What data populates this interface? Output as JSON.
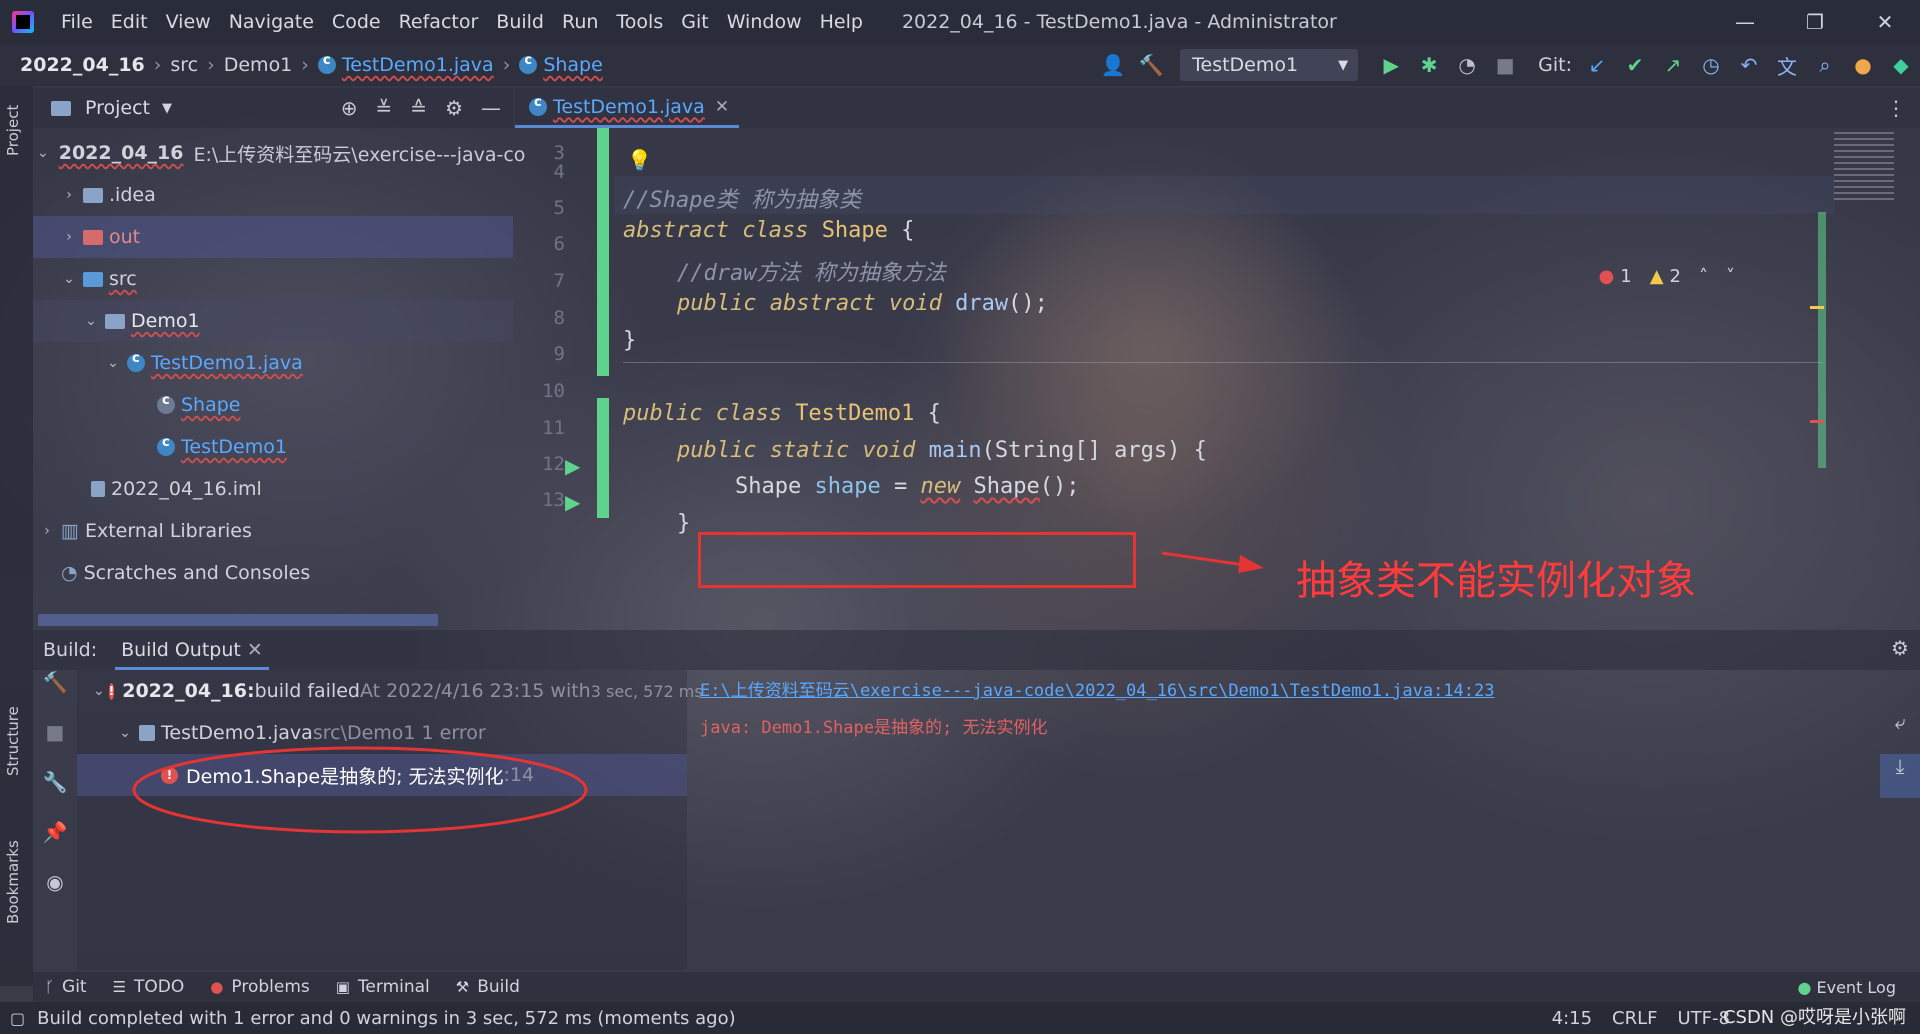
{
  "window": {
    "title": "2022_04_16 - TestDemo1.java - Administrator",
    "menu": [
      "File",
      "Edit",
      "View",
      "Navigate",
      "Code",
      "Refactor",
      "Build",
      "Run",
      "Tools",
      "Git",
      "Window",
      "Help"
    ],
    "controls": {
      "minimize": "—",
      "restore": "❐",
      "close": "✕"
    }
  },
  "breadcrumb": [
    "2022_04_16",
    "src",
    "Demo1",
    "TestDemo1.java",
    "Shape"
  ],
  "toolbar": {
    "run_config": "TestDemo1",
    "git_label": "Git:"
  },
  "left_stripe": {
    "project": "Project",
    "structure": "Structure",
    "bookmarks": "Bookmarks"
  },
  "project_panel": {
    "title": "Project",
    "tree": [
      {
        "label": "2022_04_16",
        "path": "E:\\上传资料至码云\\exercise---java-co"
      },
      {
        "label": ".idea"
      },
      {
        "label": "out"
      },
      {
        "label": "src"
      },
      {
        "label": "Demo1"
      },
      {
        "label": "TestDemo1.java"
      },
      {
        "label": "Shape"
      },
      {
        "label": "TestDemo1"
      },
      {
        "label": "2022_04_16.iml"
      },
      {
        "label": "External Libraries"
      },
      {
        "label": "Scratches and Consoles"
      }
    ]
  },
  "editor": {
    "tab": "TestDemo1.java",
    "errors": "1",
    "warnings": "2",
    "line_numbers": [
      "3",
      "4",
      "5",
      "6",
      "7",
      "8",
      "9",
      "10",
      "11",
      "12",
      "13"
    ],
    "code": {
      "l4": "//Shape类 称为抽象类",
      "l5_kw": "abstract class ",
      "l5_cls": "Shape",
      "l5_tail": " {",
      "l6": "//draw方法 称为抽象方法",
      "l7_kw": "public abstract void ",
      "l7_fn": "draw",
      "l7_tail": "();",
      "l8": "}",
      "l10_kw": "public class ",
      "l10_cls": "TestDemo1",
      "l10_tail": " {",
      "l11_kw": "public static void ",
      "l11_fn": "main",
      "l11_tail": "(String[] args) {",
      "l12_type": "Shape ",
      "l12_var": "shape",
      "l12_eq": " = ",
      "l12_new": "new",
      "l12_sp": " ",
      "l12_cls": "Shape",
      "l12_tail": "();",
      "l13": "}"
    },
    "annotation": "抽象类不能实例化对象"
  },
  "build": {
    "label": "Build:",
    "tab": "Build Output",
    "root_title": "2022_04_16:",
    "root_status": " build failed",
    "root_time": " At 2022/4/16 23:15 with ",
    "root_duration": "3 sec, 572 ms",
    "file": "TestDemo1.java",
    "file_detail": " src\\Demo1 1 error",
    "error": "Demo1.Shape是抽象的; 无法实例化",
    "error_line": " :14",
    "detail_link": "E:\\上传资料至码云\\exercise---java-code\\2022_04_16\\src\\Demo1\\TestDemo1.java:14:23",
    "detail_msg": "java: Demo1.Shape是抽象的; 无法实例化"
  },
  "bottom_tabs": [
    "Git",
    "TODO",
    "Problems",
    "Terminal",
    "Build"
  ],
  "event_log": "Event Log",
  "status": {
    "message": "Build completed with 1 error and 0 warnings in 3 sec, 572 ms (moments ago)",
    "position": "4:15",
    "line_sep": "CRLF",
    "encoding": "UTF-8",
    "watermark": "CSDN @哎呀是小张啊"
  },
  "colors": {
    "accent": "#58a9ff",
    "error": "#e05252",
    "annotation": "#ff3b3b",
    "changebar": "#5fd38d"
  }
}
